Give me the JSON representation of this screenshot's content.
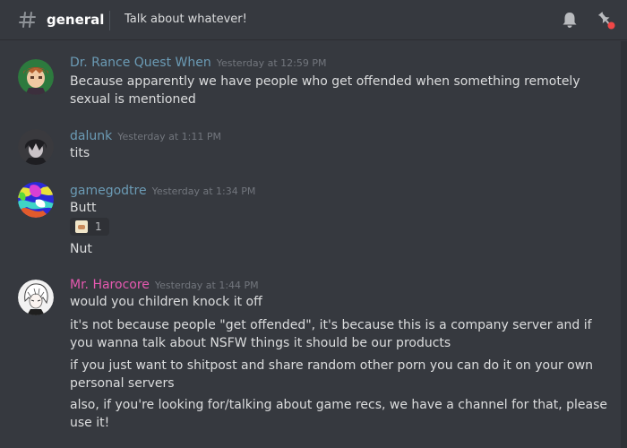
{
  "header": {
    "channel_icon": "hash-icon",
    "channel_name": "general",
    "topic": "Talk about whatever!",
    "bell_icon": "bell-icon",
    "pin_icon": "pin-icon"
  },
  "messages": [
    {
      "username": "Dr. Rance Quest When",
      "timestamp": "Yesterday at 12:59 PM",
      "lines": [
        "Because apparently we have people who get offended when something remotely sexual is mentioned"
      ]
    },
    {
      "username": "dalunk",
      "timestamp": "Yesterday at 1:11 PM",
      "lines": [
        "tits"
      ]
    },
    {
      "username": "gamegodtre",
      "timestamp": "Yesterday at 1:34 PM",
      "lines": [
        "Butt",
        "Nut"
      ],
      "reaction": {
        "count": "1"
      }
    },
    {
      "username": "Mr. Harocore",
      "timestamp": "Yesterday at 1:44 PM",
      "username_color": "#e659b0",
      "lines": [
        "would you children knock it off",
        "it's not because people \"get offended\", it's because this is a company server and if you wanna talk about NSFW things it should be our products",
        "if you just want to shitpost and share random other porn you can do it on your own personal servers",
        "also, if you're looking for/talking about game recs, we have a channel for that, please use it!"
      ]
    }
  ],
  "colors": {
    "background": "#36393f",
    "username_default": "#6b9bb5",
    "username_pink": "#e659b0",
    "text": "#dcddde",
    "timestamp": "#72767d",
    "notification_dot": "#f04747"
  }
}
